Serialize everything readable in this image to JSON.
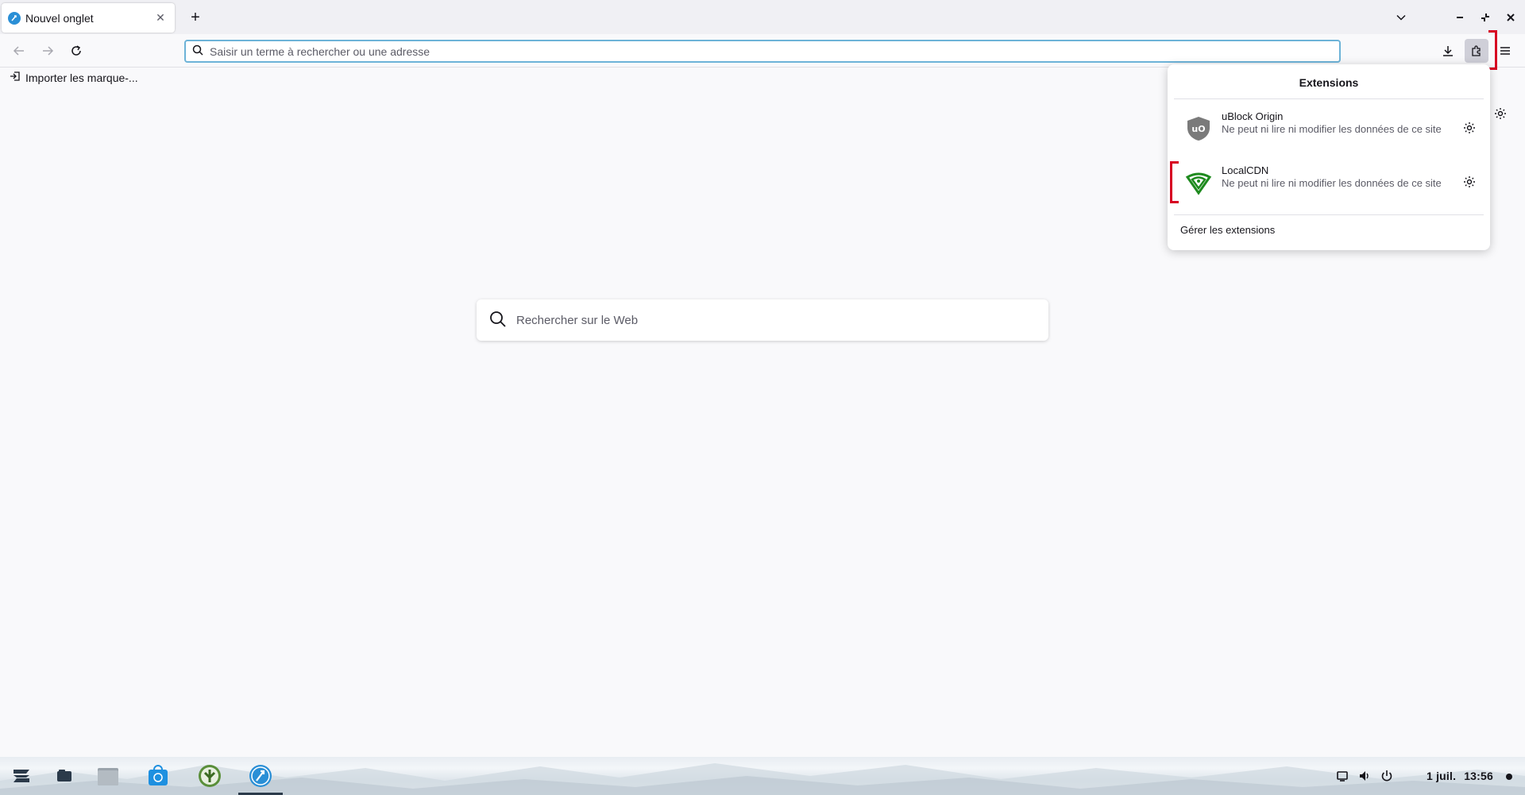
{
  "tab": {
    "title": "Nouvel onglet"
  },
  "urlbar": {
    "placeholder": "Saisir un terme à rechercher ou une adresse"
  },
  "bookmarks": {
    "import_label": "Importer les marque-..."
  },
  "extensions_panel": {
    "title": "Extensions",
    "items": [
      {
        "name": "uBlock Origin",
        "description": "Ne peut ni lire ni modifier les données de ce site",
        "icon": "ublock-origin-icon"
      },
      {
        "name": "LocalCDN",
        "description": "Ne peut ni lire ni modifier les données de ce site",
        "icon": "localcdn-icon"
      }
    ],
    "manage_label": "Gérer les extensions"
  },
  "search": {
    "placeholder": "Rechercher sur le Web"
  },
  "taskbar": {
    "clock_date": "1 juil.",
    "clock_time": "13:56"
  },
  "colors": {
    "accent": "#6db3d8",
    "highlight": "#d70022",
    "localcdn_green": "#1e8a1e",
    "ublock_gray": "#7a7a7a"
  }
}
